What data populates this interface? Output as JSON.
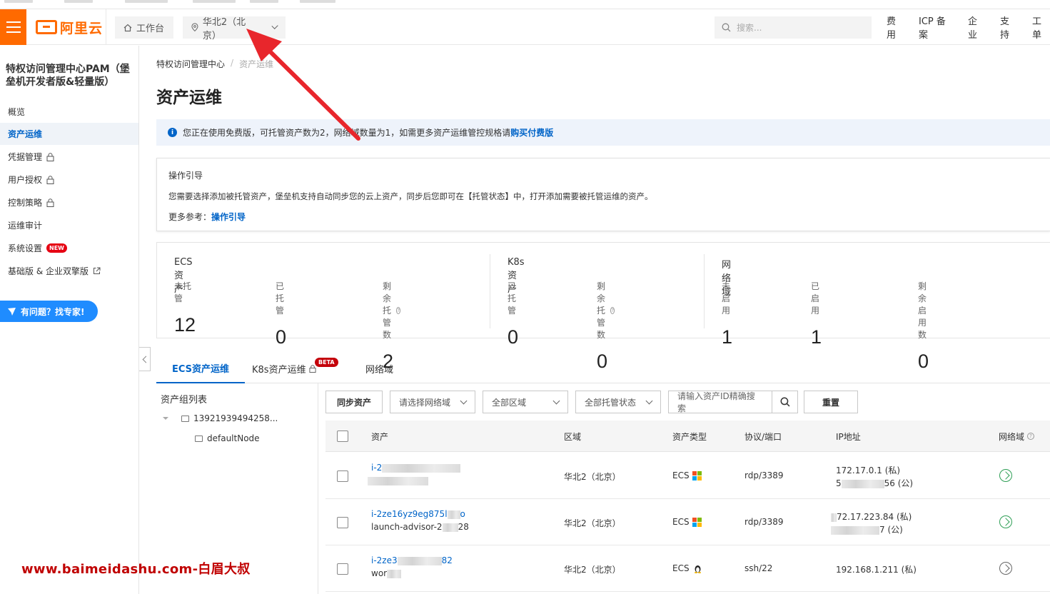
{
  "topbar": {
    "logo_text": "阿里云",
    "workbench_label": "工作台",
    "region_label": "华北2（北京）",
    "search_placeholder": "搜索...",
    "links": [
      "费用",
      "ICP 备案",
      "企业",
      "支持",
      "工单"
    ]
  },
  "sidebar": {
    "title": "特权访问管理中心PAM（堡垒机开发者版&轻量版）",
    "items": [
      {
        "label": "概览",
        "locked": false
      },
      {
        "label": "资产运维",
        "active": true
      },
      {
        "label": "凭据管理",
        "locked": true
      },
      {
        "label": "用户授权",
        "locked": true
      },
      {
        "label": "控制策略",
        "locked": true
      },
      {
        "label": "运维审计"
      },
      {
        "label": "系统设置",
        "badge": "NEW"
      },
      {
        "label": "基础版 & 企业双擎版",
        "external": true
      }
    ],
    "ask_button": "有问题？找专家!"
  },
  "breadcrumb": {
    "root": "特权访问管理中心",
    "current": "资产运维"
  },
  "page_title": "资产运维",
  "notice": {
    "text": "您正在使用免费版，可托管资产数为2，网络域数量为1，如需更多资产运维管控规格请",
    "link": "购买付费版"
  },
  "guide": {
    "title": "操作引导",
    "body": "您需要选择添加被托管资产，堡垒机支持自动同步您的云上资产，同步后您即可在【托管状态】中，打开添加需要被托管运维的资产。",
    "more_label": "更多参考：",
    "more_link": "操作引导"
  },
  "stats": {
    "ecs": {
      "title": "ECS资产",
      "unmanaged_label": "未托管",
      "unmanaged": "12",
      "managed_label": "已托管",
      "managed": "0",
      "remaining_label": "剩余托管数",
      "remaining": "2"
    },
    "k8s": {
      "title": "K8s资产",
      "managed_label": "已托管",
      "managed": "0",
      "remaining_label": "剩余托管数",
      "remaining": "0"
    },
    "network": {
      "title": "网络域",
      "disabled_label": "未启用",
      "disabled": "1",
      "enabled_label": "已启用",
      "enabled": "1",
      "remaining_label": "剩余启用数",
      "remaining": "0"
    }
  },
  "tabs": {
    "ecs": "ECS资产运维",
    "k8s": "K8s资产运维",
    "beta": "BETA",
    "network": "网络域"
  },
  "tree": {
    "title": "资产组列表",
    "root": "13921939494258...",
    "child": "defaultNode"
  },
  "toolbar": {
    "sync": "同步资产",
    "network_select": "请选择网络域",
    "region_select": "全部区域",
    "status_select": "全部托管状态",
    "search_placeholder": "请输入资产ID精确搜索",
    "reset": "重置"
  },
  "table": {
    "headers": {
      "asset": "资产",
      "region": "区域",
      "type": "资产类型",
      "protocol": "协议/端口",
      "ip": "IP地址",
      "network": "网络域"
    },
    "rows": [
      {
        "id": "i-2",
        "name": "",
        "region": "华北2（北京）",
        "type": "ECS",
        "os": "windows",
        "protocol": "rdp/3389",
        "ip1": "172.17.0.1 (私)",
        "ip2_prefix": "5",
        "ip2_suffix": "56 (公)",
        "net": "connected"
      },
      {
        "id": "i-2ze16yz9eg875l",
        "id_suffix": "o",
        "name": "launch-advisor-2",
        "name_suffix": "28",
        "region": "华北2（北京）",
        "type": "ECS",
        "os": "windows",
        "protocol": "rdp/3389",
        "ip1": "72.17.223.84 (私)",
        "ip2_suffix": "7 (公)",
        "net": "connected"
      },
      {
        "id": "i-2ze3",
        "id_suffix": "82",
        "name": "wor",
        "region": "华北2（北京）",
        "type": "ECS",
        "os": "linux",
        "protocol": "ssh/22",
        "ip1": "192.168.1.211 (私)",
        "net": "disconnected"
      }
    ]
  },
  "watermark": "www.baimeidashu.com-白眉大叔"
}
